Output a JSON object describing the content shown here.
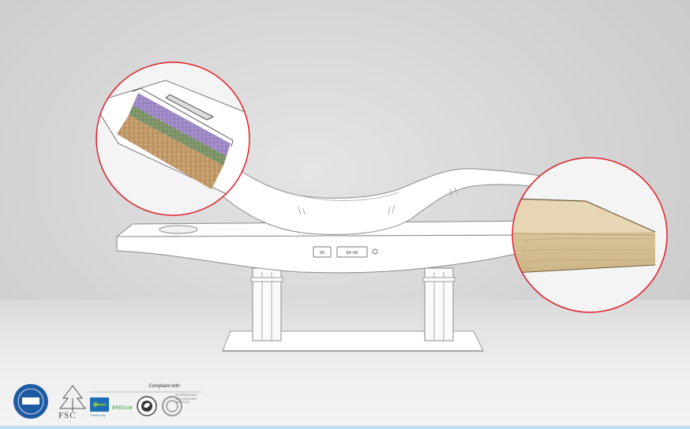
{
  "logos": {
    "compliant_label": "Compliant with",
    "fsc_label": "FSC",
    "gold_label": "GOLD",
    "breeam_label": "BREEAM",
    "green_key_label": "Green Key",
    "well_label": "INTERNATIONAL WELL BUILDING INSTITUTE"
  },
  "colors": {
    "callout_ring": "#e0202a",
    "foam_top": "#9b86c2",
    "foam_mid": "#7f9468",
    "foam_core": "#c29b6a",
    "wood": "#d8c39a"
  }
}
